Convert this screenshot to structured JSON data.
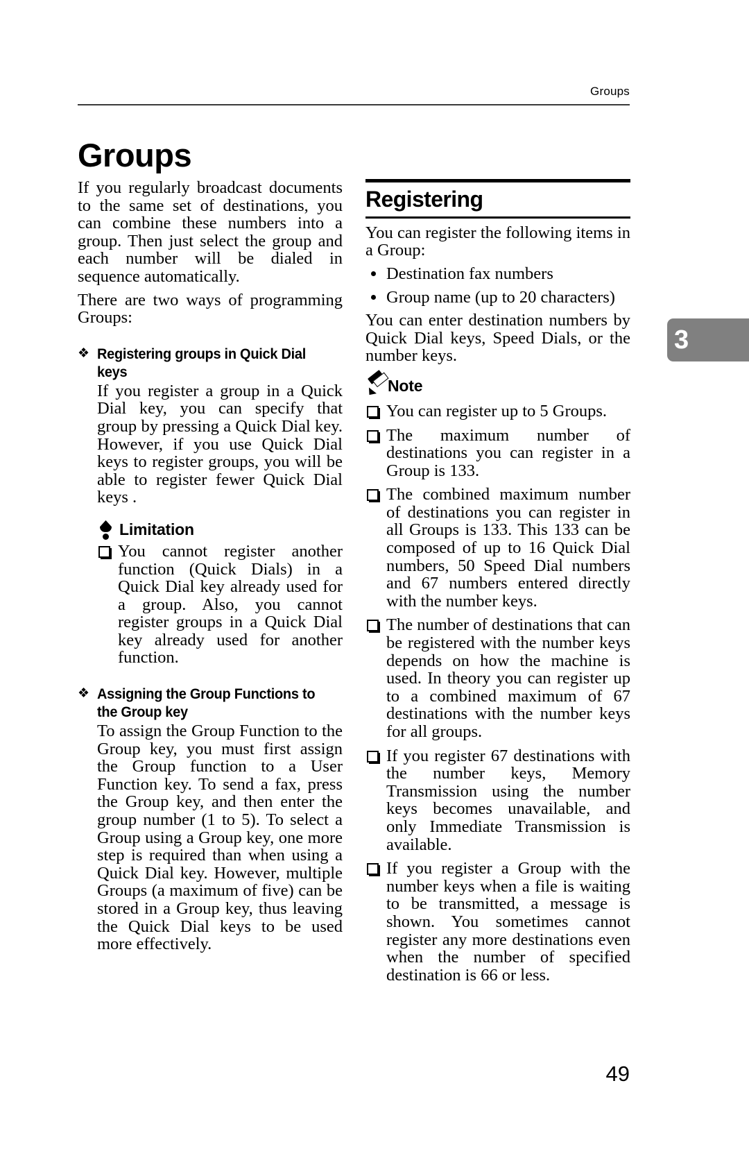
{
  "header": {
    "running_head": "Groups",
    "chapter_tab_number": "3",
    "chapter_tab_color": "#808080"
  },
  "title": "Groups",
  "left_column": {
    "intro_paragraph_1": "If you regularly broadcast documents to the same set of destinations, you can combine these numbers into a group. Then just select the group and each number will be dialed in sequence automatically.",
    "intro_paragraph_2": "There are two ways of programming Groups:",
    "sections": [
      {
        "bullet_glyph": "❖",
        "heading": "Registering groups in Quick Dial keys",
        "body": "If you register a group in a Quick Dial key, you can specify that group by pressing a Quick Dial key. However, if you use Quick Dial keys to register groups, you will be able to register fewer Quick Dial keys .",
        "callout": {
          "icon": "limitation-bulb-icon",
          "label": "Limitation",
          "items": [
            "You cannot register another function (Quick Dials) in a Quick Dial key already used for a group. Also, you cannot register groups in a Quick Dial key already used for another function."
          ]
        }
      },
      {
        "bullet_glyph": "❖",
        "heading": "Assigning the Group Functions to the Group key",
        "body": "To assign the Group Function to the Group key, you must first assign the Group function to a User Function key. To send a fax, press the Group key, and then enter the group number (1 to 5). To select a Group using a Group key, one more step is required than when using a Quick Dial key. However, multiple Groups (a maximum of five) can be stored in a Group key, thus leaving the Quick Dial keys to be used more effectively."
      }
    ]
  },
  "right_column": {
    "section_heading": "Registering",
    "intro": "You can register the following items in a Group:",
    "dot_items": [
      "Destination fax numbers",
      "Group name (up to 20 characters)"
    ],
    "after_list": "You can enter destination numbers by Quick Dial keys, Speed Dials, or the number keys.",
    "note": {
      "icon": "note-pencil-icon",
      "label": "Note",
      "items": [
        "You can register up to 5 Groups.",
        "The maximum number of destinations you can register in a Group is 133.",
        "The combined maximum number of destinations you can register in all Groups is 133. This 133 can be composed of up to 16 Quick Dial numbers, 50 Speed Dial numbers and 67 numbers entered directly with the number keys.",
        "The number of destinations that can be registered with the number keys depends on how the machine is used. In theory you can register up to a combined maximum of 67 destinations with the number keys for all groups.",
        "If you register 67 destinations with the number keys, Memory Transmission using the number keys becomes unavailable, and only Immediate Transmission is available.",
        "If you register a Group with the number keys when a file is waiting to be transmitted, a message is shown. You sometimes cannot register any more destinations even when the number of specified destination is 66 or less."
      ]
    }
  },
  "footer": {
    "page_number": "49"
  }
}
